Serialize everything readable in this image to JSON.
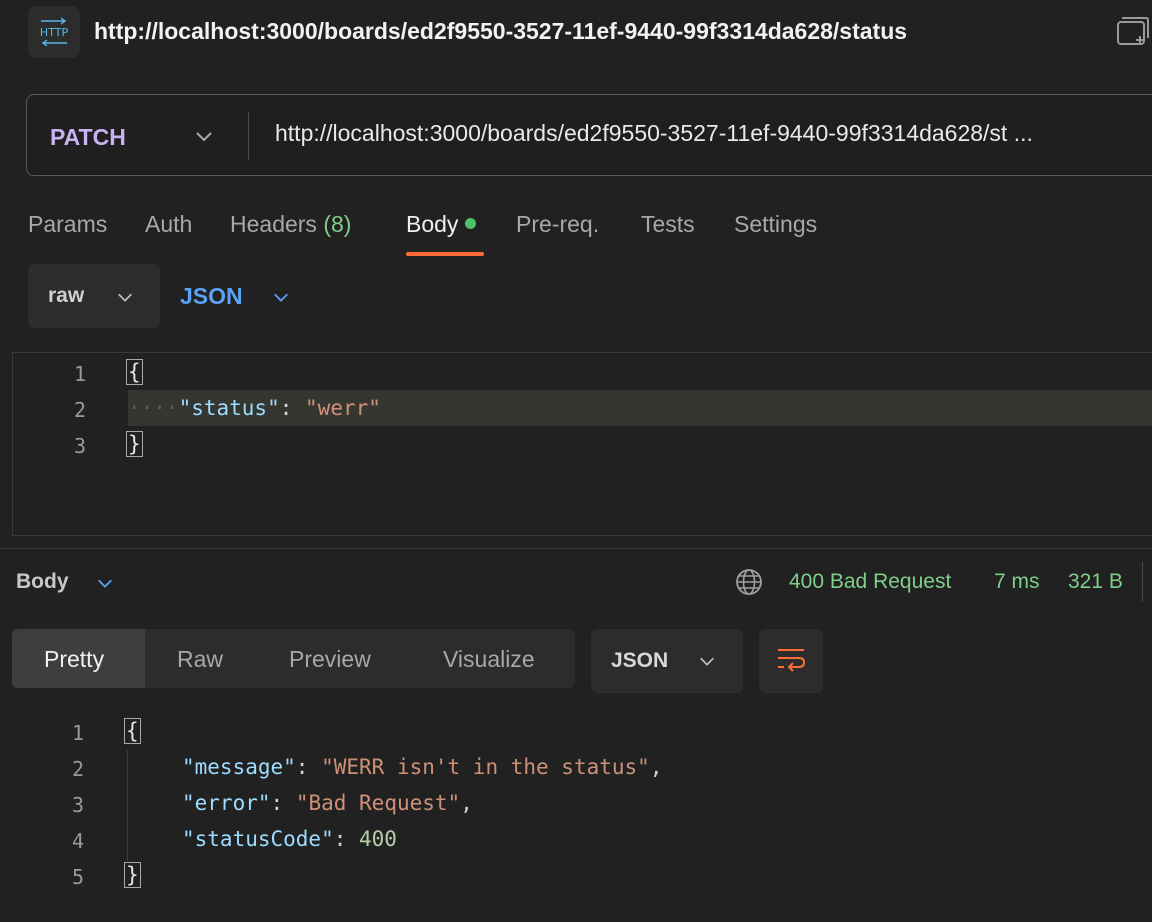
{
  "header": {
    "badge_icon": "http-icon",
    "title": "http://localhost:3000/boards/ed2f9550-3527-11ef-9440-99f3314da628/status"
  },
  "request": {
    "method": "PATCH",
    "url": "http://localhost:3000/boards/ed2f9550-3527-11ef-9440-99f3314da628/st ..."
  },
  "tabs": [
    {
      "label": "Params",
      "active": false
    },
    {
      "label": "Auth",
      "active": false
    },
    {
      "label": "Headers",
      "count": "(8)",
      "active": false
    },
    {
      "label": "Body",
      "active": true,
      "indicator_color": "#4cc16b"
    },
    {
      "label": "Pre-req.",
      "active": false
    },
    {
      "label": "Tests",
      "active": false
    },
    {
      "label": "Settings",
      "active": false
    }
  ],
  "body_mode": {
    "type": "raw",
    "format": "JSON"
  },
  "request_editor": {
    "line_numbers": [
      "1",
      "2",
      "3"
    ],
    "open_brace": "{",
    "key": "\"status\"",
    "colon": ": ",
    "value": "\"werr\"",
    "close_brace": "}"
  },
  "response": {
    "section_label": "Body",
    "status": "400 Bad Request",
    "time": "7 ms",
    "size": "321 B",
    "status_color": "#7fcf8a",
    "view_tabs": [
      "Pretty",
      "Raw",
      "Preview",
      "Visualize"
    ],
    "active_view": "Pretty",
    "format": "JSON",
    "line_numbers": [
      "1",
      "2",
      "3",
      "4",
      "5"
    ],
    "open_brace": "{",
    "close_brace": "}",
    "message_key": "\"message\"",
    "message_value": "\"WERR isn't in the status\"",
    "error_key": "\"error\"",
    "error_value": "\"Bad Request\"",
    "code_key": "\"statusCode\"",
    "code_value": "400"
  },
  "colors": {
    "accent_underline": "#ff6c37",
    "method": "#c7b3f2",
    "json_link": "#5aa2f5"
  }
}
